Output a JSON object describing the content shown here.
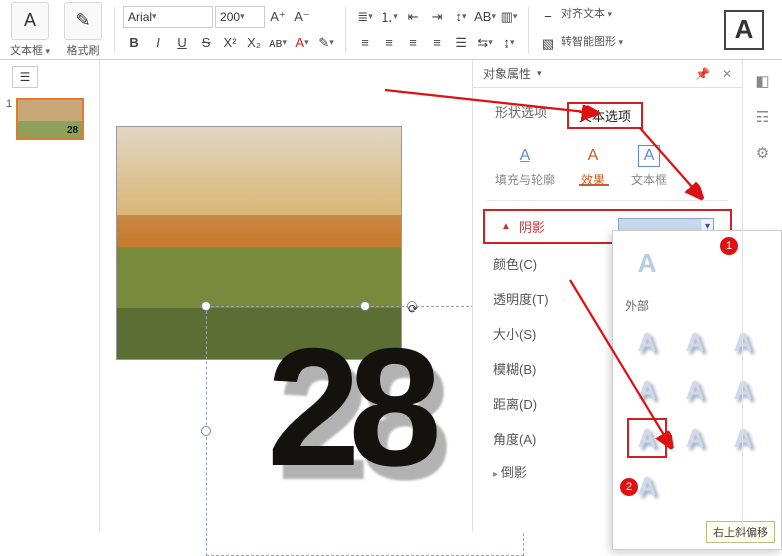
{
  "ribbon": {
    "textbox_label": "文本框",
    "format_painter_label": "格式刷",
    "font_name": "Arial",
    "font_size": "200",
    "align_text_label": "对齐文本",
    "smart_art_label": "转智能图形",
    "bold": "B",
    "italic": "I",
    "underline": "U",
    "strike": "S",
    "superscript": "X²",
    "subscript": "X₂",
    "big_A": "A"
  },
  "thumbnail": {
    "index": "1",
    "preview_text": "28"
  },
  "slide": {
    "big_text": "28"
  },
  "panel": {
    "title": "对象属性",
    "tabs": {
      "shape": "形状选项",
      "text": "文本选项"
    },
    "subtabs": {
      "fill": "填充与轮廓",
      "effect": "效果",
      "textbox": "文本框"
    },
    "shadow_section": "阴影",
    "props": {
      "color": "颜色(C)",
      "transparency": "透明度(T)",
      "size": "大小(S)",
      "blur": "模糊(B)",
      "distance": "距离(D)",
      "angle": "角度(A)"
    },
    "reflection_section": "倒影"
  },
  "gallery": {
    "outer_label": "外部",
    "tooltip": "右上斜偏移"
  },
  "annotations": {
    "circle1": "1",
    "circle2": "2"
  }
}
